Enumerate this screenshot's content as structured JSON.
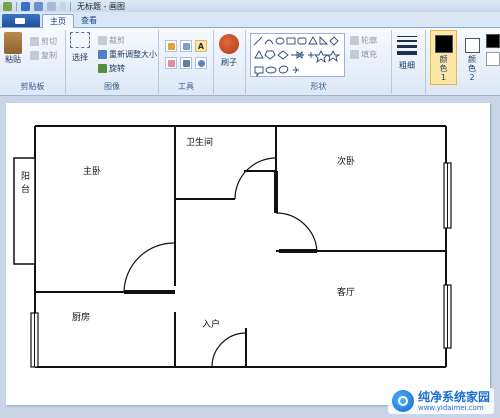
{
  "window": {
    "title": "无标题 - 画图"
  },
  "tabs": {
    "file_label": "",
    "home": "主页",
    "view": "查看"
  },
  "ribbon": {
    "clipboard": {
      "label": "剪贴板",
      "paste": "粘贴",
      "cut": "剪切",
      "copy": "复制"
    },
    "image": {
      "label": "图像",
      "select": "选择",
      "crop": "裁剪",
      "resize": "重新调整大小",
      "rotate": "旋转"
    },
    "tools": {
      "label": "工具",
      "text_tool": "A"
    },
    "brushes": {
      "label": "刷子"
    },
    "shapes": {
      "label": "形状",
      "outline": "轮廓",
      "fill": "填充"
    },
    "size": {
      "label": "粗细"
    },
    "colors": {
      "color1": "颜色 1",
      "color2": "颜色 2"
    }
  },
  "canvas": {
    "rooms": {
      "master_bedroom": "主卧",
      "bathroom": "卫生间",
      "second_bedroom": "次卧",
      "balcony": "阳台",
      "living_room": "客厅",
      "kitchen": "厨房",
      "entrance": "入户"
    }
  },
  "watermark": {
    "title": "纯净系统家园",
    "url": "www.yidaimei.com"
  }
}
